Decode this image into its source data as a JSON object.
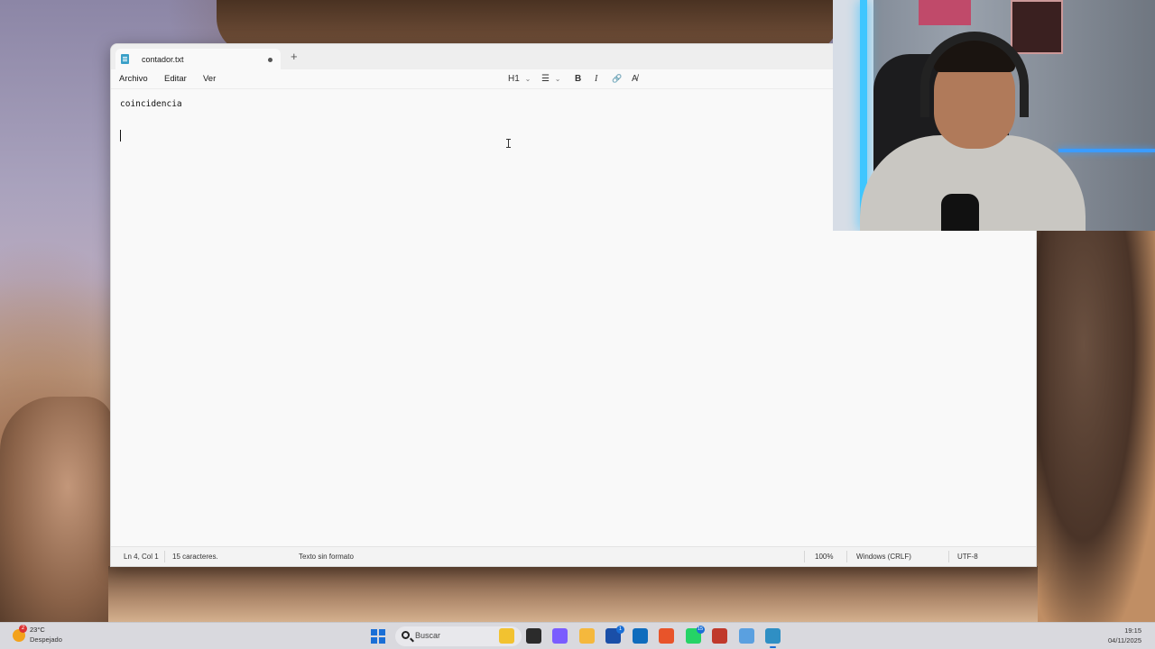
{
  "window": {
    "tab_title": "contador.txt",
    "tab_modified_indicator": "●",
    "new_tab_label": "+"
  },
  "menu": {
    "items": [
      "Archivo",
      "Editar",
      "Ver"
    ]
  },
  "toolbar": {
    "heading_label": "H1",
    "heading_chevron": "⌄",
    "list_icon": "☰",
    "list_chevron": "⌄",
    "bold_label": "B",
    "italic_label": "I",
    "link_icon": "🔗",
    "clear_format_icon": "A̸"
  },
  "editor": {
    "lines": [
      "coincidencia",
      "",
      ""
    ]
  },
  "status": {
    "position": "Ln 4, Col 1",
    "char_count": "15 caracteres.",
    "format": "Texto sin formato",
    "zoom": "100%",
    "line_ending": "Windows (CRLF)",
    "encoding": "UTF-8"
  },
  "taskbar": {
    "weather_temp": "23°C",
    "weather_desc": "Despejado",
    "weather_badge": "2",
    "search_placeholder": "Buscar",
    "apps": [
      {
        "name": "file-explorer-icon",
        "color": "#f2c230"
      },
      {
        "name": "terminal-icon",
        "color": "#2b2b2b"
      },
      {
        "name": "copilot-icon",
        "color": "#7a5cff"
      },
      {
        "name": "folder-icon",
        "color": "#f5b83d"
      },
      {
        "name": "store-icon",
        "color": "#1a4fa8",
        "badge": "1"
      },
      {
        "name": "outlook-icon",
        "color": "#0f6cbd"
      },
      {
        "name": "firefox-icon",
        "color": "#e8542a"
      },
      {
        "name": "whatsapp-icon",
        "color": "#25d366",
        "badge": "15"
      },
      {
        "name": "app-icon",
        "color": "#c0392b"
      },
      {
        "name": "vscode-icon",
        "color": "#5aa0e0"
      },
      {
        "name": "notepad-icon",
        "color": "#2f8fc4",
        "active": true
      }
    ],
    "clock_time": "19:15",
    "clock_date": "04/11/2025"
  }
}
